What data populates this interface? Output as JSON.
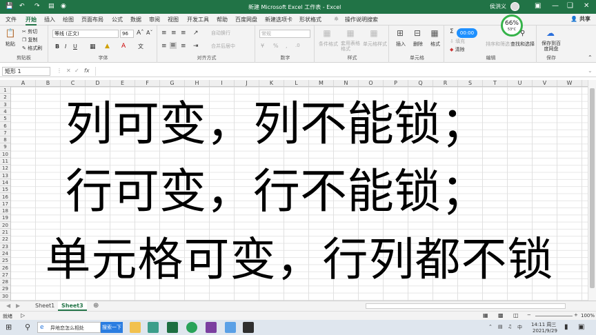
{
  "titlebar": {
    "title": "新建 Microsoft Excel 工作表 - Excel",
    "user": "侯洪义"
  },
  "tabs": [
    "文件",
    "开始",
    "插入",
    "绘图",
    "页面布局",
    "公式",
    "数据",
    "审阅",
    "视图",
    "开发工具",
    "帮助",
    "百度网盘",
    "新建选项卡",
    "形状格式"
  ],
  "tell_me": "操作说明搜索",
  "share": "共享",
  "ribbon": {
    "clipboard": {
      "label": "剪贴板",
      "paste": "粘贴",
      "cut": "剪切",
      "copy": "复制",
      "format_painter": "格式刷"
    },
    "font": {
      "label": "字体",
      "name": "等线 (正文)",
      "size": "96"
    },
    "align": {
      "label": "对齐方式",
      "wrap": "自动换行",
      "merge": "合并后居中"
    },
    "number": {
      "label": "数字",
      "format": "常规"
    },
    "styles": {
      "label": "样式",
      "cond": "条件格式",
      "table": "套用表格格式",
      "cell": "单元格样式"
    },
    "cells": {
      "label": "单元格",
      "insert": "插入",
      "delete": "删除",
      "format": "格式"
    },
    "edit": {
      "label": "编辑",
      "fill": "填充",
      "clear": "清除",
      "sort": "排序和筛选",
      "find": "查找和选择"
    },
    "save": {
      "label": "保存",
      "baidu": "保存到百度网盘"
    },
    "timer": "00:00",
    "perf": "66%",
    "temp": "53°C"
  },
  "formula": {
    "namebox": "矩形 1",
    "fx": "fx",
    "value": ""
  },
  "columns": [
    "A",
    "B",
    "C",
    "D",
    "E",
    "F",
    "G",
    "H",
    "I",
    "J",
    "K",
    "L",
    "M",
    "N",
    "O",
    "P",
    "Q",
    "R",
    "S",
    "T",
    "U",
    "V",
    "W"
  ],
  "rows": [
    "1",
    "2",
    "3",
    "4",
    "5",
    "6",
    "7",
    "8",
    "9",
    "10",
    "11",
    "12",
    "13",
    "14",
    "15",
    "16",
    "17",
    "18",
    "19",
    "20",
    "21",
    "22",
    "23",
    "24",
    "25",
    "26",
    "27",
    "28",
    "29",
    "30"
  ],
  "content": {
    "line1": "列可变，列不能锁；",
    "line2": "行可变，行不能锁；",
    "line3": "单元格可变，行列都不锁"
  },
  "sheets": [
    "Sheet1",
    "Sheet3"
  ],
  "status": {
    "ready": "就绪",
    "zoom": "100%"
  },
  "taskbar": {
    "search_text": "异地恋怎么相处",
    "search_btn": "搜索一下",
    "time": "14:11 周三",
    "date": "2021/9/29"
  },
  "colors": {
    "accent": "#217346",
    "perf_ring": "#36b34a"
  }
}
